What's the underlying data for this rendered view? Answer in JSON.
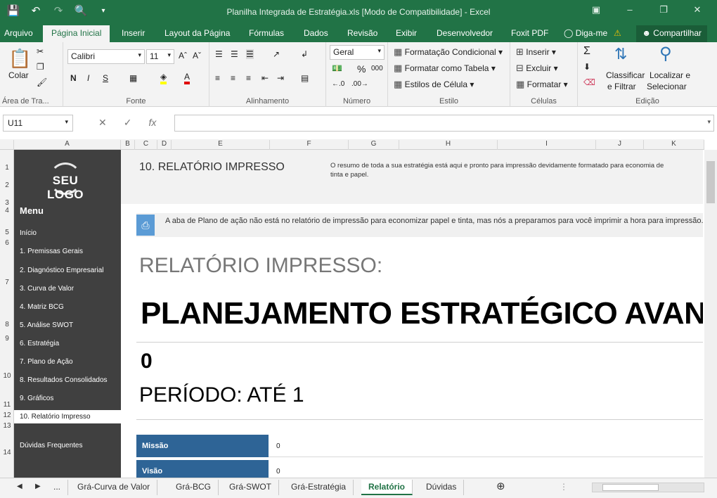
{
  "window": {
    "title": "Planilha Integrada de Estratégia.xls  [Modo de Compatibilidade] - Excel"
  },
  "menu_tabs": [
    "Arquivo",
    "Página Inicial",
    "Inserir",
    "Layout da Página",
    "Fórmulas",
    "Dados",
    "Revisão",
    "Exibir",
    "Desenvolvedor",
    "Foxit PDF",
    "Diga-me"
  ],
  "share_label": "Compartilhar",
  "ribbon": {
    "clipboard": {
      "paste": "Colar",
      "label": "Área de Tra..."
    },
    "font": {
      "name": "Calibri",
      "size": "11",
      "bold": "N",
      "italic": "I",
      "underline": "S",
      "label": "Fonte"
    },
    "alignment": {
      "label": "Alinhamento"
    },
    "number": {
      "format": "Geral",
      "percent": "%",
      "thousands": "000",
      "label": "Número"
    },
    "styles": {
      "conditional": "Formatação Condicional",
      "table": "Formatar como Tabela",
      "cell": "Estilos de Célula",
      "label": "Estilo"
    },
    "cells": {
      "insert": "Inserir",
      "delete": "Excluir",
      "format": "Formatar",
      "label": "Células"
    },
    "editing": {
      "sort1": "Classificar",
      "sort2": "e Filtrar",
      "find1": "Localizar e",
      "find2": "Selecionar",
      "label": "Edição"
    }
  },
  "formula_bar": {
    "name_box": "U11",
    "fx": "fx",
    "formula": ""
  },
  "columns": [
    "A",
    "B",
    "C",
    "D",
    "E",
    "F",
    "G",
    "H",
    "I",
    "J",
    "K"
  ],
  "rows": [
    "1",
    "2",
    "3",
    "4",
    "5",
    "6",
    "7",
    "8",
    "9",
    "10",
    "11",
    "12",
    "13",
    "14"
  ],
  "sidebar": {
    "logo": "SEU LOGO",
    "menu_title": "Menu",
    "items": [
      "Início",
      "1. Premissas Gerais",
      "2. Diagnóstico Empresarial",
      "3. Curva de Valor",
      "4. Matriz BCG",
      "5. Análise SWOT",
      "6. Estratégia",
      "7. Plano de Ação",
      "8. Resultados Consolidados",
      "9. Gráficos",
      "10. Relatório Impresso",
      "Dúvidas Frequentes"
    ]
  },
  "report": {
    "section_title": "10. RELATÓRIO IMPRESSO",
    "section_desc": "O resumo de toda a sua estratégia está aqui e pronto para impressão devidamente formatado para economia de tinta e papel.",
    "info": "A aba de Plano de ação não está no relatório de impressão para economizar papel e tinta, mas nós a preparamos para você imprimir a hora para impressão.",
    "subtitle": "RELATÓRIO IMPRESSO:",
    "main_title": "PLANEJAMENTO ESTRATÉGICO AVANÇ",
    "company": "0",
    "period": "PERÍODO:  ATÉ 1",
    "rows": [
      {
        "label": "Missão",
        "value": "0"
      },
      {
        "label": "Visão",
        "value": "0"
      }
    ]
  },
  "sheet_tabs": [
    "...",
    "Grá-Curva de Valor",
    "Grá-BCG",
    "Grá-SWOT",
    "Grá-Estratégia",
    "Relatório",
    "Dúvidas"
  ],
  "active_sheet": "Relatório",
  "colors": {
    "excel_green": "#217346",
    "sidebar": "#404040",
    "table_blue": "#2e6496",
    "print_icon": "#5b9bd5"
  }
}
